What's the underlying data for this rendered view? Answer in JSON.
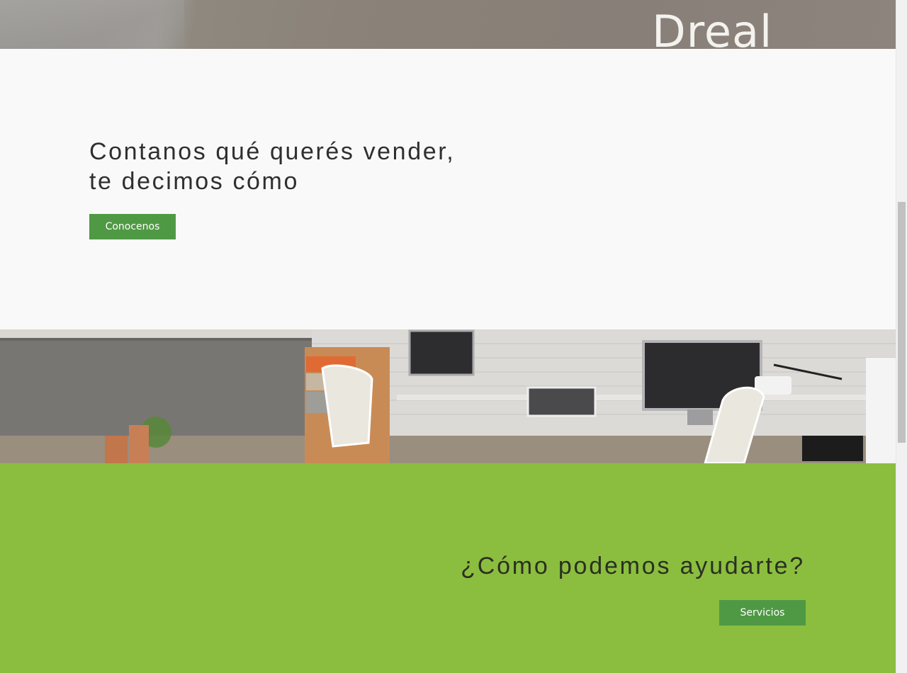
{
  "hero": {
    "brand_text": "Dreal"
  },
  "intro": {
    "heading_line1": "Contanos qué querés vender,",
    "heading_line2": "te decimos cómo",
    "button_label": "Conocenos"
  },
  "help": {
    "heading": "¿Cómo podemos ayudarte?",
    "button_label": "Servicios"
  },
  "colors": {
    "button_green": "#4f9944",
    "section_green": "#8bbe3f",
    "light_bg": "#f9f9f9",
    "heading_text": "#2f2f2f"
  },
  "images": {
    "office_photo": "office-workspace-photo"
  }
}
